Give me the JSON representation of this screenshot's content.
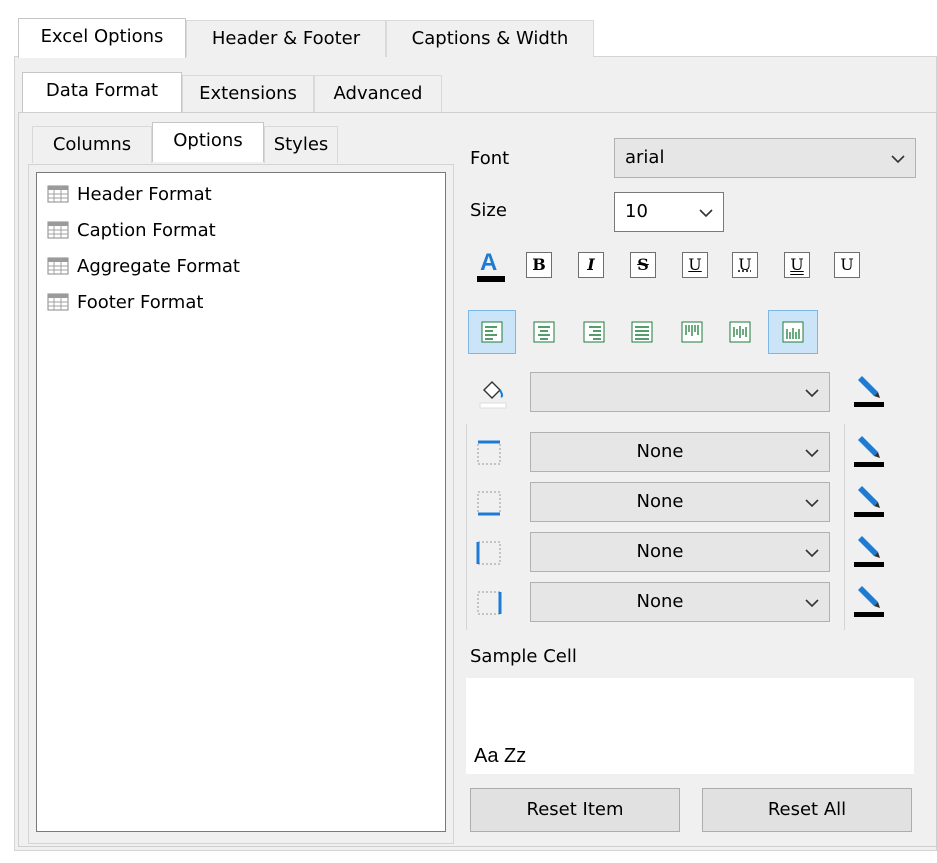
{
  "top_tabs": [
    "Excel Options",
    "Header & Footer",
    "Captions & Width"
  ],
  "mid_tabs": [
    "Data Format",
    "Extensions",
    "Advanced"
  ],
  "inner_tabs": [
    "Columns",
    "Options",
    "Styles"
  ],
  "format_list": [
    "Header Format",
    "Caption Format",
    "Aggregate Format",
    "Footer Format"
  ],
  "font": {
    "label": "Font",
    "value": "arial"
  },
  "size": {
    "label": "Size",
    "value": "10"
  },
  "style_buttons": [
    "B",
    "I",
    "S",
    "U",
    "U",
    "U",
    "U"
  ],
  "borders": [
    "None",
    "None",
    "None",
    "None"
  ],
  "sample": {
    "label": "Sample Cell",
    "text": "Aa Zz"
  },
  "buttons": {
    "reset_item": "Reset Item",
    "reset_all": "Reset All"
  },
  "colors": {
    "accent": "#1e7bd4",
    "selected_bg": "#cce4f7",
    "panel_bg": "#f0f0f0"
  }
}
